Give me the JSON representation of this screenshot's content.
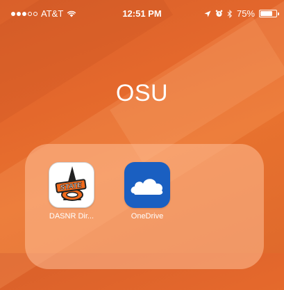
{
  "status_bar": {
    "carrier": "AT&T",
    "signal_bars_filled": 3,
    "signal_bars_total": 5,
    "time": "12:51 PM",
    "battery_percent": "75%",
    "battery_level": 0.75
  },
  "folder": {
    "title": "OSU",
    "apps": [
      {
        "label": "DASNR Dir...",
        "icon": "osu-state-logo-icon"
      },
      {
        "label": "OneDrive",
        "icon": "onedrive-cloud-icon"
      }
    ]
  },
  "colors": {
    "background": "#e4682c",
    "folder_panel": "#f1a983",
    "onedrive_blue": "#1a5fc1",
    "osu_orange": "#f26a1b"
  }
}
